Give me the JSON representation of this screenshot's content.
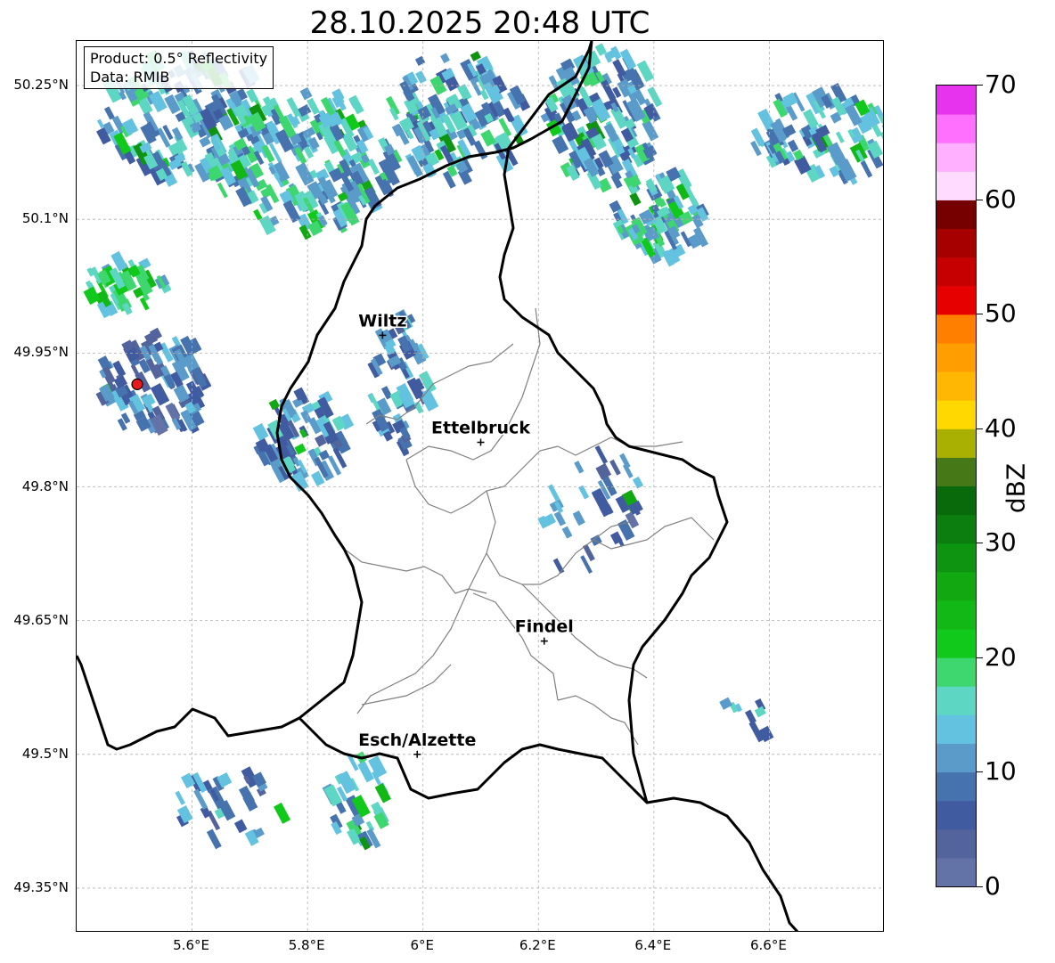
{
  "title": "28.10.2025 20:48 UTC",
  "info": {
    "product": "Product: 0.5° Reflectivity",
    "source": "Data: RMIB"
  },
  "axes": {
    "lon_range": [
      5.4,
      6.8
    ],
    "lat_range": [
      49.3,
      50.3
    ],
    "lat_ticks": [
      {
        "value": 50.25,
        "label": "50.25°N"
      },
      {
        "value": 50.1,
        "label": "50.1°N"
      },
      {
        "value": 49.95,
        "label": "49.95°N"
      },
      {
        "value": 49.8,
        "label": "49.8°N"
      },
      {
        "value": 49.65,
        "label": "49.65°N"
      },
      {
        "value": 49.5,
        "label": "49.5°N"
      },
      {
        "value": 49.35,
        "label": "49.35°N"
      }
    ],
    "lon_ticks": [
      {
        "value": 5.6,
        "label": "5.6°E"
      },
      {
        "value": 5.8,
        "label": "5.8°E"
      },
      {
        "value": 6.0,
        "label": "6°E"
      },
      {
        "value": 6.2,
        "label": "6.2°E"
      },
      {
        "value": 6.4,
        "label": "6.4°E"
      },
      {
        "value": 6.6,
        "label": "6.6°E"
      }
    ],
    "grid": true
  },
  "places": [
    {
      "name": "Wiltz",
      "lon": 5.93,
      "lat": 49.97
    },
    {
      "name": "Ettelbruck",
      "lon": 6.1,
      "lat": 49.85
    },
    {
      "name": "Findel",
      "lon": 6.21,
      "lat": 49.627
    },
    {
      "name": "Esch/Alzette",
      "lon": 5.99,
      "lat": 49.5
    }
  ],
  "radar_site": {
    "lon": 5.505,
    "lat": 49.915,
    "color": "#e8181b"
  },
  "colorbar": {
    "label": "dBZ",
    "min": 0,
    "max": 70,
    "ticks": [
      0,
      10,
      20,
      30,
      40,
      50,
      60,
      70
    ],
    "colors": [
      "#6373a8",
      "#53649c",
      "#415ba0",
      "#4672ad",
      "#5a9bc9",
      "#63c2e0",
      "#5dd6c3",
      "#3ed66e",
      "#10c91b",
      "#12b816",
      "#12a812",
      "#0e9410",
      "#0b7e0f",
      "#086a0b",
      "#477818",
      "#aab002",
      "#fed800",
      "#ffb703",
      "#ff9e00",
      "#ff7f00",
      "#e70000",
      "#c60000",
      "#a60000",
      "#760000",
      "#ffdcff",
      "#ffb0ff",
      "#ff70ff",
      "#e833ee"
    ]
  },
  "echo_clusters": [
    {
      "lon": 5.58,
      "lat": 50.22,
      "rx": 0.16,
      "ry": 0.07,
      "n": 160,
      "level": 12
    },
    {
      "lon": 5.78,
      "lat": 50.17,
      "rx": 0.16,
      "ry": 0.08,
      "n": 180,
      "level": 14
    },
    {
      "lon": 6.05,
      "lat": 50.22,
      "rx": 0.12,
      "ry": 0.07,
      "n": 130,
      "level": 12
    },
    {
      "lon": 6.3,
      "lat": 50.22,
      "rx": 0.1,
      "ry": 0.08,
      "n": 130,
      "level": 12
    },
    {
      "lon": 6.4,
      "lat": 50.11,
      "rx": 0.08,
      "ry": 0.05,
      "n": 80,
      "level": 14
    },
    {
      "lon": 6.68,
      "lat": 50.2,
      "rx": 0.12,
      "ry": 0.05,
      "n": 90,
      "level": 13
    },
    {
      "lon": 5.52,
      "lat": 49.92,
      "rx": 0.1,
      "ry": 0.06,
      "n": 90,
      "level": 8
    },
    {
      "lon": 5.78,
      "lat": 49.86,
      "rx": 0.08,
      "ry": 0.05,
      "n": 70,
      "level": 10
    },
    {
      "lon": 5.95,
      "lat": 49.92,
      "rx": 0.05,
      "ry": 0.08,
      "n": 60,
      "level": 10
    },
    {
      "lon": 5.47,
      "lat": 50.03,
      "rx": 0.07,
      "ry": 0.03,
      "n": 40,
      "level": 18
    },
    {
      "lon": 5.65,
      "lat": 49.44,
      "rx": 0.1,
      "ry": 0.05,
      "n": 30,
      "level": 10
    },
    {
      "lon": 5.88,
      "lat": 49.45,
      "rx": 0.06,
      "ry": 0.05,
      "n": 30,
      "level": 14
    },
    {
      "lon": 6.28,
      "lat": 49.78,
      "rx": 0.09,
      "ry": 0.08,
      "n": 35,
      "level": 8
    },
    {
      "lon": 6.55,
      "lat": 49.55,
      "rx": 0.04,
      "ry": 0.05,
      "n": 8,
      "level": 10
    }
  ]
}
